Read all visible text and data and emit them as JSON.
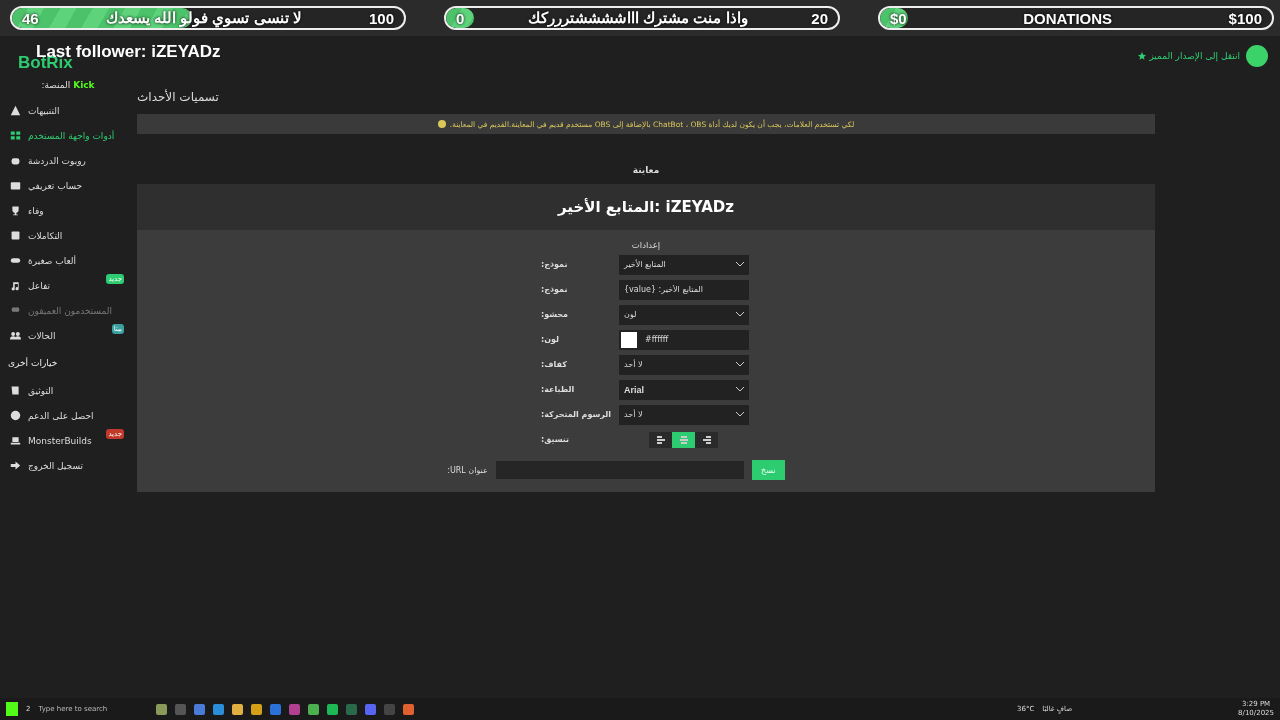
{
  "overlay": {
    "followers_goal": {
      "current": "46",
      "label": "لا تنسى تسوي فولو الله يسعدك",
      "target": "100",
      "level": 0.46
    },
    "subscribers_goal": {
      "current": "0",
      "label": "واذا منت مشترك اااششششتررركك",
      "target": "20",
      "level": 0.0
    },
    "donations_goal": {
      "current": "$0",
      "label": "DONATIONS",
      "target": "$100",
      "level": 0.0
    },
    "last_follower": "Last follower: iZEYADz"
  },
  "header": {
    "logo": "BotRix",
    "upgrade_link": "انتقل إلى الإصدار المميز"
  },
  "sidebar": {
    "platform_label": "المنصة:",
    "platform": "Kick",
    "items": [
      {
        "label": "التنبيهات",
        "selected": false,
        "disabled": false
      },
      {
        "label": "أدوات واجهة المستخدم",
        "selected": true,
        "disabled": false
      },
      {
        "label": "روبوت الدردشة",
        "selected": false,
        "disabled": false
      },
      {
        "label": "حساب تعريفي",
        "selected": false,
        "disabled": false
      },
      {
        "label": "وفاء",
        "selected": false,
        "disabled": false
      },
      {
        "label": "التكاملات",
        "selected": false,
        "disabled": false
      },
      {
        "label": "ألعاب صغيرة",
        "selected": false,
        "disabled": false
      },
      {
        "label": "تفاعل",
        "selected": false,
        "disabled": false,
        "badge": "جديد",
        "color": "#2ecc71"
      },
      {
        "label": "المستخدمون العميقون",
        "selected": false,
        "disabled": true
      },
      {
        "label": "الحالات",
        "selected": false,
        "disabled": false,
        "badge": "بيتا",
        "color": "#3aa0a0"
      }
    ],
    "section": "خيارات أخرى",
    "other_items": [
      {
        "label": "التوثيق",
        "selected": false,
        "disabled": false
      },
      {
        "label": "احصل على الدعم",
        "selected": false,
        "disabled": false
      },
      {
        "label": "MonsterBuilds",
        "selected": false,
        "disabled": false,
        "badge": "جديد",
        "color": "#c0392b"
      },
      {
        "label": "تسجيل الخروج",
        "selected": false,
        "disabled": false
      }
    ]
  },
  "main": {
    "title": "تسميات الأحداث",
    "notice": "لكي تستخدم العلامات، يجب أن يكون لديك أداة ChatBot ، OBS بالإضافة إلى OBS مستخدم قديم في المعاينة.القديم في المعاينة.",
    "preview_title": "معاينة",
    "preview_text": "المتابع الأخير: iZEYADz",
    "settings_title": "إعدادات",
    "settings": [
      {
        "kind": "select",
        "label": "نموذج:",
        "value": "المتابع الأخير"
      },
      {
        "kind": "input",
        "label": "نموذج:",
        "value": "المتابع الأخير: {value}"
      },
      {
        "kind": "select",
        "label": "محشو:",
        "value": "لون"
      },
      {
        "kind": "color",
        "label": "لون:",
        "value": "#ffffff"
      },
      {
        "kind": "select",
        "label": "كفاف:",
        "value": "لا أحد"
      },
      {
        "kind": "font",
        "label": "الطباعة:",
        "value": "Arial"
      },
      {
        "kind": "select",
        "label": "الرسوم المتحركة:",
        "value": "لا أحد"
      },
      {
        "kind": "align",
        "label": "تنسيق:",
        "options": [
          {
            "selected": false
          },
          {
            "selected": true
          },
          {
            "selected": false
          }
        ]
      }
    ],
    "url_label": "عنوان URL:",
    "copy_button": "نسخ"
  },
  "taskbar": {
    "badge": "2",
    "search_placeholder": "Type here to search",
    "weather": "36°C",
    "weather_text": "صافٍ غالبًا",
    "time": "3:29 PM",
    "date": "8/10/2025"
  }
}
